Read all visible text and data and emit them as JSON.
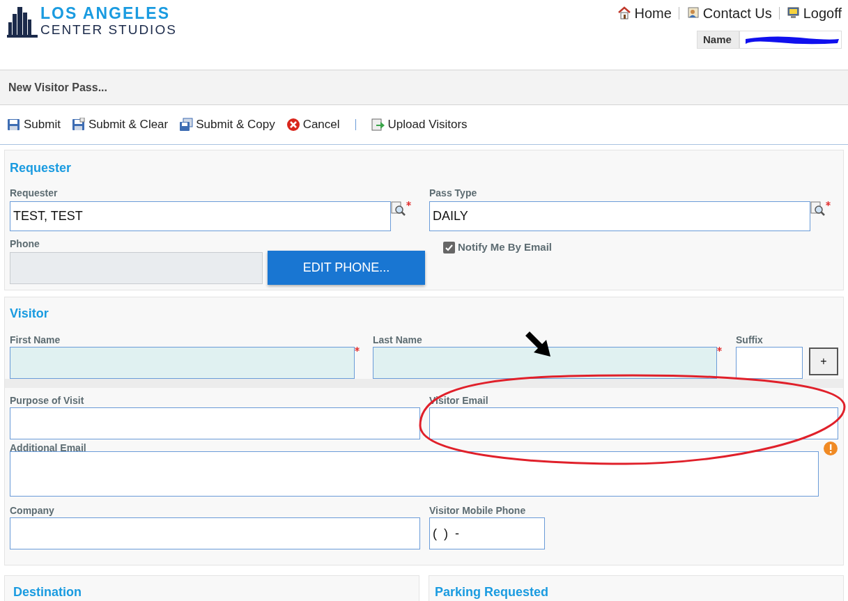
{
  "logo": {
    "line1": "LOS ANGELES",
    "line2": "CENTER STUDIOS"
  },
  "nav": [
    {
      "label": "Home",
      "kind": "home"
    },
    {
      "label": "Contact Us",
      "kind": "contact"
    },
    {
      "label": "Logoff",
      "kind": "logoff"
    }
  ],
  "user": {
    "label": "Name",
    "value_redacted": true
  },
  "page_title": "New Visitor Pass...",
  "toolbar": [
    {
      "label": "Submit",
      "kind": "save"
    },
    {
      "label": "Submit & Clear",
      "kind": "save-clear"
    },
    {
      "label": "Submit & Copy",
      "kind": "copy"
    },
    {
      "label": "Cancel",
      "kind": "cancel"
    },
    {
      "kind": "separator"
    },
    {
      "label": "Upload Visitors",
      "kind": "upload"
    }
  ],
  "requester_section": {
    "heading": "Requester",
    "requester": {
      "label": "Requester",
      "value": "TEST, TEST",
      "required": true,
      "lookup": true
    },
    "pass_type": {
      "label": "Pass Type",
      "value": "DAILY",
      "required": true,
      "lookup": true
    },
    "phone": {
      "label": "Phone",
      "disabled": true
    },
    "edit_phone_button": "EDIT PHONE...",
    "notify": {
      "label": "Notify Me By Email",
      "checked": true
    }
  },
  "visitor_section": {
    "heading": "Visitor",
    "first_name": {
      "label": "First Name",
      "required": true,
      "highlighted": true
    },
    "last_name": {
      "label": "Last Name",
      "required": true,
      "highlighted": true
    },
    "suffix": {
      "label": "Suffix"
    },
    "add_button": "+",
    "purpose": {
      "label": "Purpose of Visit"
    },
    "visitor_email": {
      "label": "Visitor Email"
    },
    "additional_email": {
      "label": "Additional Email",
      "warning": true
    },
    "company": {
      "label": "Company"
    },
    "mobile_phone": {
      "label": "Visitor Mobile Phone",
      "value": "(  )  -"
    }
  },
  "destination_section": {
    "heading": "Destination"
  },
  "parking_section": {
    "heading": "Parking Requested"
  },
  "annotations": {
    "arrow": true,
    "highlight_ellipse": true
  }
}
